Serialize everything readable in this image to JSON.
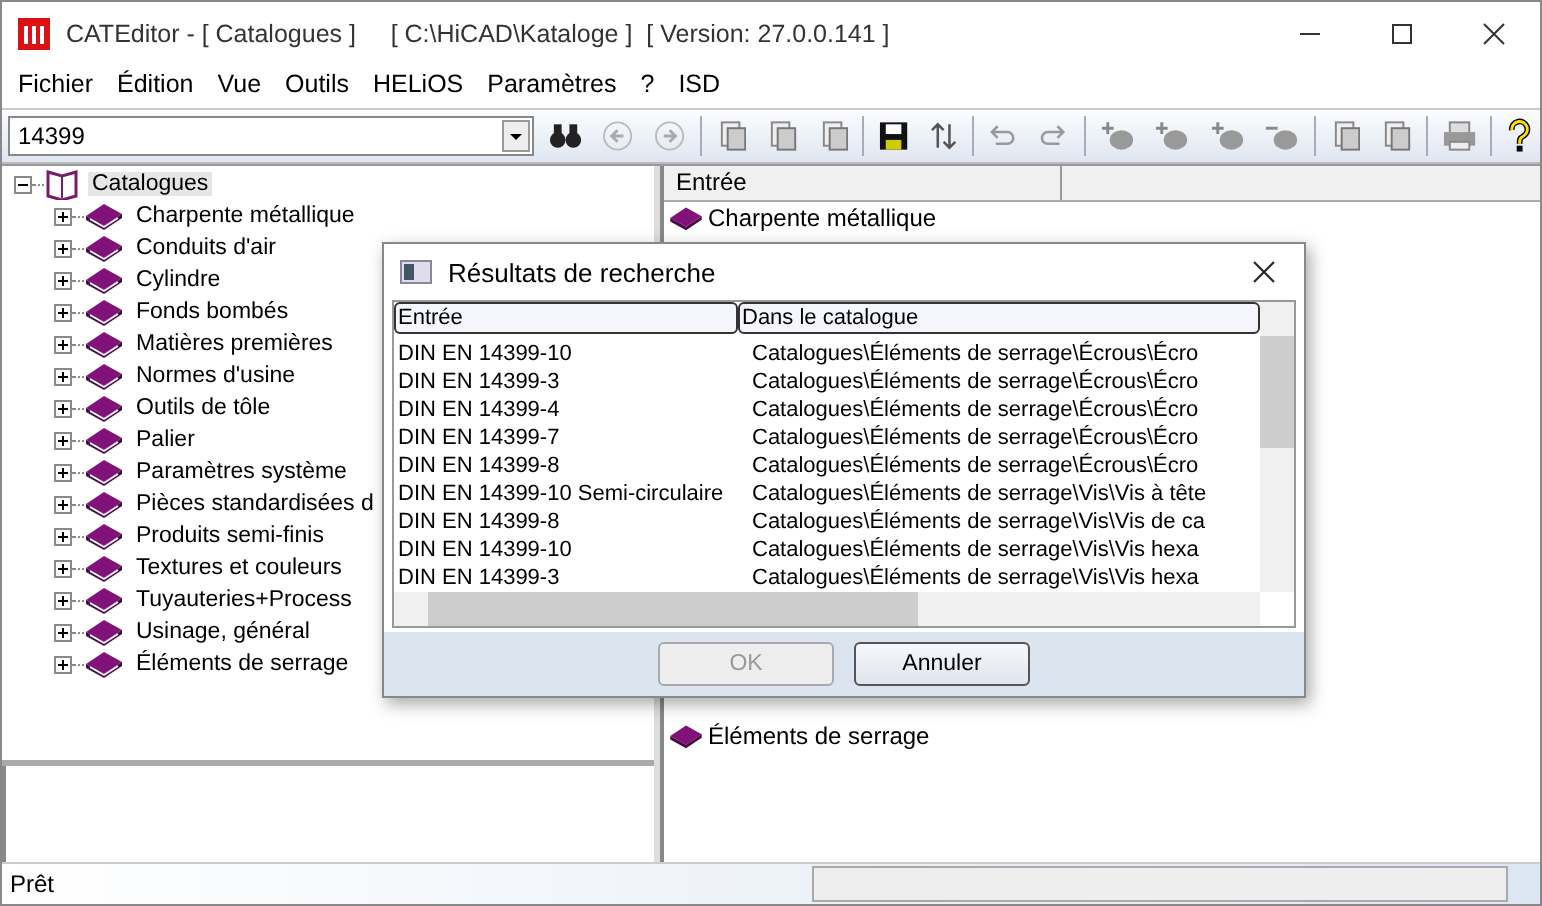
{
  "window": {
    "title": "CATEditor - [ Catalogues ]     [ C:\\HiCAD\\Kataloge ]  [ Version: 27.0.0.141 ]"
  },
  "menu": [
    "Fichier",
    "Édition",
    "Vue",
    "Outils",
    "HELiOS",
    "Paramètres",
    "?",
    "ISD"
  ],
  "search": {
    "value": "14399"
  },
  "tree": {
    "label": "Catalogues",
    "expanded": true,
    "selected": true,
    "children": [
      {
        "label": "Charpente métallique",
        "expanded": false,
        "selected": false
      },
      {
        "label": "Conduits d'air",
        "expanded": false,
        "selected": false
      },
      {
        "label": "Cylindre",
        "expanded": false,
        "selected": false
      },
      {
        "label": "Fonds bombés",
        "expanded": false,
        "selected": false
      },
      {
        "label": "Matières premières",
        "expanded": false,
        "selected": false
      },
      {
        "label": "Normes d'usine",
        "expanded": false,
        "selected": false
      },
      {
        "label": "Outils de tôle",
        "expanded": false,
        "selected": false
      },
      {
        "label": "Palier",
        "expanded": false,
        "selected": false
      },
      {
        "label": "Paramètres système",
        "expanded": false,
        "selected": false
      },
      {
        "label": "Pièces standardisées d",
        "expanded": false,
        "selected": false
      },
      {
        "label": "Produits semi-finis",
        "expanded": false,
        "selected": false
      },
      {
        "label": "Textures et couleurs",
        "expanded": false,
        "selected": false
      },
      {
        "label": "Tuyauteries+Process",
        "expanded": false,
        "selected": false
      },
      {
        "label": "Usinage, général",
        "expanded": false,
        "selected": false
      },
      {
        "label": "Éléments de serrage",
        "expanded": false,
        "selected": false
      }
    ]
  },
  "list": {
    "columns": [
      "Entrée"
    ],
    "items": [
      "Charpente métallique",
      "Éléments de serrage"
    ]
  },
  "dialog": {
    "title": "Résultats de recherche",
    "columns": [
      "Entrée",
      "Dans le catalogue"
    ],
    "rows": [
      {
        "entry": "DIN EN 14399-10",
        "catalog": "Catalogues\\Éléments de serrage\\Écrous\\Écro"
      },
      {
        "entry": "DIN EN 14399-3",
        "catalog": "Catalogues\\Éléments de serrage\\Écrous\\Écro"
      },
      {
        "entry": "DIN EN 14399-4",
        "catalog": "Catalogues\\Éléments de serrage\\Écrous\\Écro"
      },
      {
        "entry": "DIN EN 14399-7",
        "catalog": "Catalogues\\Éléments de serrage\\Écrous\\Écro"
      },
      {
        "entry": "DIN EN 14399-8",
        "catalog": "Catalogues\\Éléments de serrage\\Écrous\\Écro"
      },
      {
        "entry": "DIN EN 14399-10 Semi-circulaire",
        "catalog": "Catalogues\\Éléments de serrage\\Vis\\Vis à tête"
      },
      {
        "entry": "DIN EN 14399-8",
        "catalog": "Catalogues\\Éléments de serrage\\Vis\\Vis de ca"
      },
      {
        "entry": "DIN EN 14399-10",
        "catalog": "Catalogues\\Éléments de serrage\\Vis\\Vis hexa"
      },
      {
        "entry": "DIN EN 14399-3",
        "catalog": "Catalogues\\Éléments de serrage\\Vis\\Vis hexa"
      }
    ],
    "buttons": [
      {
        "label": "OK",
        "disabled": true
      },
      {
        "label": "Annuler",
        "disabled": false
      }
    ]
  },
  "status_bar": {
    "text": "Prêt"
  }
}
